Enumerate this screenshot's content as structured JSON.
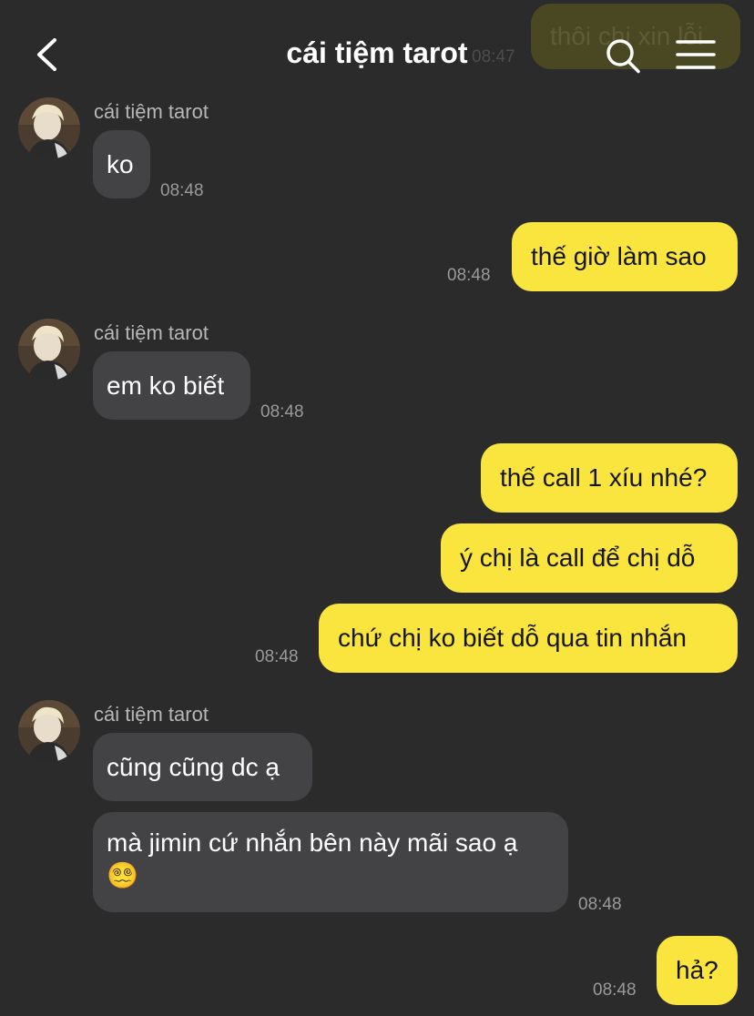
{
  "header": {
    "title": "cái tiệm tarot"
  },
  "ghost": {
    "text": "thôi chị xin lỗi",
    "time": "08:47"
  },
  "messages": {
    "m1": {
      "sender": "cái tiệm tarot",
      "text": "ko",
      "time": "08:48"
    },
    "m2": {
      "text": "thế giờ làm sao",
      "time": "08:48"
    },
    "m3": {
      "sender": "cái tiệm tarot",
      "text": "em ko biết",
      "time": "08:48"
    },
    "m4": {
      "text": "thế call 1 xíu nhé?"
    },
    "m5": {
      "text": "ý chị là call để chị dỗ"
    },
    "m6": {
      "text": "chứ chị ko biết dỗ qua tin nhắn",
      "time": "08:48"
    },
    "m7": {
      "sender": "cái tiệm tarot",
      "text": "cũng cũng dc ạ"
    },
    "m8": {
      "text": "mà jimin cứ nhắn bên này mãi sao ạ",
      "emoji": "😵‍💫",
      "time": "08:48"
    },
    "m9": {
      "text": "hả?",
      "time": "08:48"
    }
  },
  "icons": {
    "back": "chevron-left-icon",
    "search": "search-icon",
    "menu": "hamburger-menu-icon"
  },
  "colors": {
    "background": "#2b2b2c",
    "incoming": "#434345",
    "outgoing": "#f9e53e"
  }
}
